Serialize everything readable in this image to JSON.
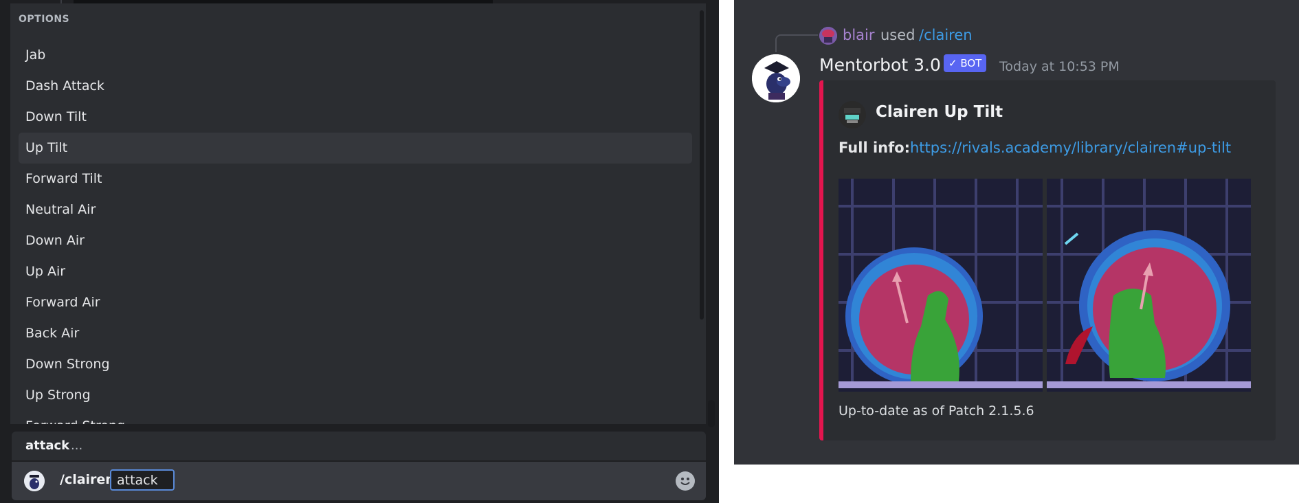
{
  "options": {
    "header": "OPTIONS",
    "items": [
      {
        "label": "Jab",
        "selected": false
      },
      {
        "label": "Dash Attack",
        "selected": false
      },
      {
        "label": "Down Tilt",
        "selected": false
      },
      {
        "label": "Up Tilt",
        "selected": true
      },
      {
        "label": "Forward Tilt",
        "selected": false
      },
      {
        "label": "Neutral Air",
        "selected": false
      },
      {
        "label": "Down Air",
        "selected": false
      },
      {
        "label": "Up Air",
        "selected": false
      },
      {
        "label": "Forward Air",
        "selected": false
      },
      {
        "label": "Back Air",
        "selected": false
      },
      {
        "label": "Down Strong",
        "selected": false
      },
      {
        "label": "Up Strong",
        "selected": false
      },
      {
        "label": "Forward Strong",
        "selected": false
      }
    ]
  },
  "param": {
    "name": "attack",
    "description": "..."
  },
  "command": {
    "name": "/clairen",
    "input_value": "attack"
  },
  "reply": {
    "user": "blair",
    "used": "used",
    "command": "/clairen"
  },
  "message": {
    "author": "Mentorbot 3.0",
    "tag": "✓ BOT",
    "timestamp": "Today at 10:53 PM"
  },
  "embed": {
    "title": "Clairen Up Tilt",
    "field_name": "Full info:",
    "link": "https://rivals.academy/library/clairen#up-tilt",
    "footer": "Up-to-date as of Patch 2.1.5.6",
    "accent_color": "#e3154e"
  },
  "colors": {
    "link": "#3d9ce6",
    "bot_tag": "#5865f2",
    "username": "#a783d0"
  }
}
